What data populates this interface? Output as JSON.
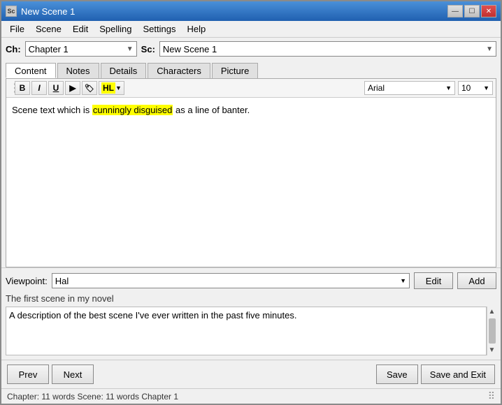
{
  "window": {
    "title": "New Scene 1",
    "icon_label": "Sc"
  },
  "toolbar": {
    "ch_label": "Ch:",
    "sc_label": "Sc:",
    "chapter_value": "Chapter 1",
    "scene_value": "New Scene 1"
  },
  "tabs": {
    "items": [
      "Content",
      "Notes",
      "Details",
      "Characters",
      "Picture"
    ]
  },
  "formatting": {
    "bold": "B",
    "italic": "I",
    "underline": "U",
    "play_btn": "▶",
    "tag_btn": "🏷",
    "hl_btn": "HL",
    "font_name": "Arial",
    "font_size": "10"
  },
  "scene_text": {
    "before_highlight": "Scene text which is ",
    "highlighted": "cunningly disguised",
    "after_highlight": " as a line of banter."
  },
  "bottom": {
    "viewpoint_label": "Viewpoint:",
    "viewpoint_value": "Hal",
    "edit_label": "Edit",
    "add_label": "Add",
    "synopsis_title": "The first scene in my novel",
    "synopsis_text": "A description of the best scene I've ever written in the past five minutes."
  },
  "footer": {
    "prev_label": "Prev",
    "next_label": "Next",
    "save_label": "Save",
    "save_next_label": "Save and Exit"
  },
  "status": {
    "text": "Chapter: 11 words  Scene: 11 words    Chapter 1"
  },
  "menu": {
    "items": [
      "File",
      "Scene",
      "Edit",
      "Spelling",
      "Settings",
      "Help"
    ]
  }
}
